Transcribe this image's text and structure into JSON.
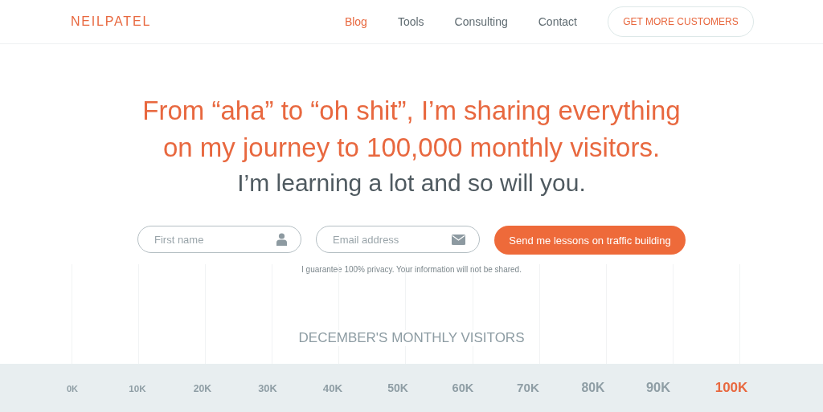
{
  "header": {
    "logo": "NEILPATEL",
    "nav": [
      {
        "label": "Blog",
        "selected": true
      },
      {
        "label": "Tools",
        "selected": false
      },
      {
        "label": "Consulting",
        "selected": false
      },
      {
        "label": "Contact",
        "selected": false
      }
    ],
    "cta": "GET MORE CUSTOMERS"
  },
  "hero": {
    "headline": [
      "From “aha” to “oh shit”, I’m sharing everything",
      "on my journey to 100,000 monthly visitors."
    ],
    "subheadline": "I’m learning a lot and so will you."
  },
  "signup": {
    "first_name": {
      "placeholder": "First name"
    },
    "email": {
      "placeholder": "Email address"
    },
    "submit": "Send me lessons on traffic building",
    "privacy": "I guarantee 100% privacy. Your information will not be shared."
  },
  "visitors": {
    "title": "DECEMBER'S MONTHLY VISITORS",
    "scale": [
      {
        "label": "0K",
        "selected": false
      },
      {
        "label": "10K",
        "selected": false
      },
      {
        "label": "20K",
        "selected": false
      },
      {
        "label": "30K",
        "selected": false
      },
      {
        "label": "40K",
        "selected": false
      },
      {
        "label": "50K",
        "selected": false
      },
      {
        "label": "60K",
        "selected": false
      },
      {
        "label": "70K",
        "selected": false
      },
      {
        "label": "80K",
        "selected": false
      },
      {
        "label": "90K",
        "selected": false
      },
      {
        "label": "100K",
        "selected": true
      }
    ]
  }
}
